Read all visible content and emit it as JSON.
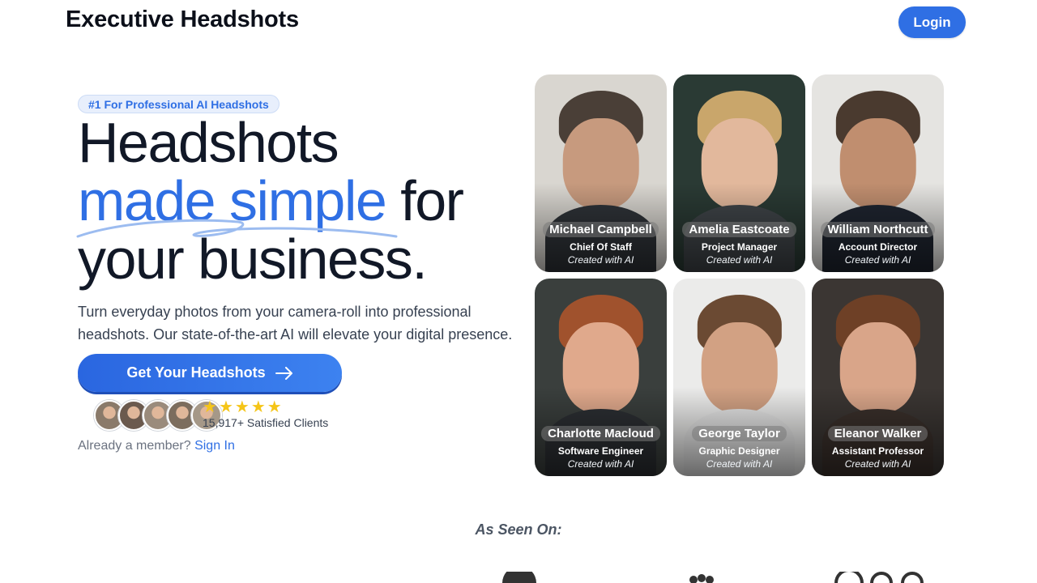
{
  "header": {
    "brand": "Executive Headshots",
    "login_label": "Login"
  },
  "hero": {
    "badge": "#1 For Professional AI Headshots",
    "headline_line1": "Headshots",
    "headline_highlight": "made simple",
    "headline_line2_rest": " for",
    "headline_line3": "your business.",
    "subtext": "Turn everyday photos from your camera-roll into professional headshots. Our state-of-the-art AI will elevate your digital presence.",
    "cta_label": "Get Your Headshots",
    "rating_stars": 5,
    "clients_text": "15,917+ Satisfied Clients",
    "member_prompt": "Already a member?",
    "sign_in_label": "Sign In"
  },
  "headshots": [
    {
      "name": "Michael Campbell",
      "role": "Chief Of Staff",
      "caption": "Created with AI",
      "bg": "#d9d6d0",
      "skin": "#c79a7e",
      "hair": "#4a3f37",
      "torso": "#2f3338"
    },
    {
      "name": "Amelia Eastcoate",
      "role": "Project Manager",
      "caption": "Created with AI",
      "bg": "#2a3a34",
      "skin": "#e2b89c",
      "hair": "#c9a66b",
      "torso": "#3f4448"
    },
    {
      "name": "William Northcutt",
      "role": "Account Director",
      "caption": "Created with AI",
      "bg": "#e5e4e1",
      "skin": "#c08e6f",
      "hair": "#4a3a2f",
      "torso": "#1f2530"
    },
    {
      "name": "Charlotte Macloud",
      "role": "Software Engineer",
      "caption": "Created with AI",
      "bg": "#3a3f3d",
      "skin": "#e0a98c",
      "hair": "#a0522d",
      "torso": "#2c2f33"
    },
    {
      "name": "George Taylor",
      "role": "Graphic Designer",
      "caption": "Created with AI",
      "bg": "#ebebea",
      "skin": "#d2a183",
      "hair": "#6b4a33",
      "torso": "#e6e6e6"
    },
    {
      "name": "Eleanor Walker",
      "role": "Assistant Professor",
      "caption": "Created with AI",
      "bg": "#3b3633",
      "skin": "#d9a589",
      "hair": "#6e4026",
      "torso": "#3a302b"
    }
  ],
  "avatars": [
    "#8a7a6a",
    "#6b5a4e",
    "#9a8b7c",
    "#7c6d5e",
    "#a59888"
  ],
  "as_seen_on": "As Seen On:",
  "colors": {
    "accent": "#2f6fe4",
    "star": "#f5c518"
  }
}
